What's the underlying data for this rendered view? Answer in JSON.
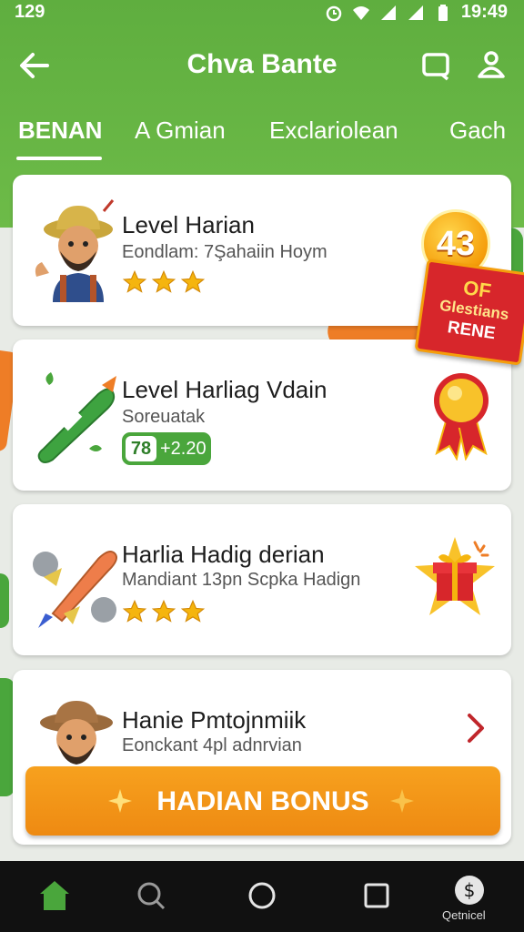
{
  "status_bar": {
    "left_text": "129",
    "time": "19:49"
  },
  "app_bar": {
    "title": "Chva Bante"
  },
  "tabs": [
    {
      "label": "BENAN",
      "active": true
    },
    {
      "label": "A Gmian",
      "active": false
    },
    {
      "label": "Exclariolean",
      "active": false
    },
    {
      "label": "Gach",
      "active": false
    }
  ],
  "cards": [
    {
      "title": "Level Harian",
      "subtitle": "Eondlam: 7Şahaiin Hoym",
      "stars": 3
    },
    {
      "title": "Level Harliag Vdain",
      "subtitle": "Soreuatak",
      "pill_left": "78",
      "pill_right": "+2.20"
    },
    {
      "title": "Harlia Hadig derian",
      "subtitle": "Mandiant 13pn Scpka Hadign",
      "stars": 3
    },
    {
      "title": "Hanie Pmtojnmiik",
      "subtitle": "Eonckant 4pl adnrvian"
    }
  ],
  "reward_badge": {
    "number": "43",
    "ribbon_line1": "OF",
    "ribbon_line2": "Glestians",
    "ribbon_line3": "RENE"
  },
  "bonus_button": {
    "label": "HADIAN BONUS"
  },
  "nav": {
    "account_label": "Qetnicel"
  },
  "colors": {
    "primary_green": "#5fae3f",
    "accent_orange": "#f39a18",
    "badge_red": "#d7262b"
  }
}
